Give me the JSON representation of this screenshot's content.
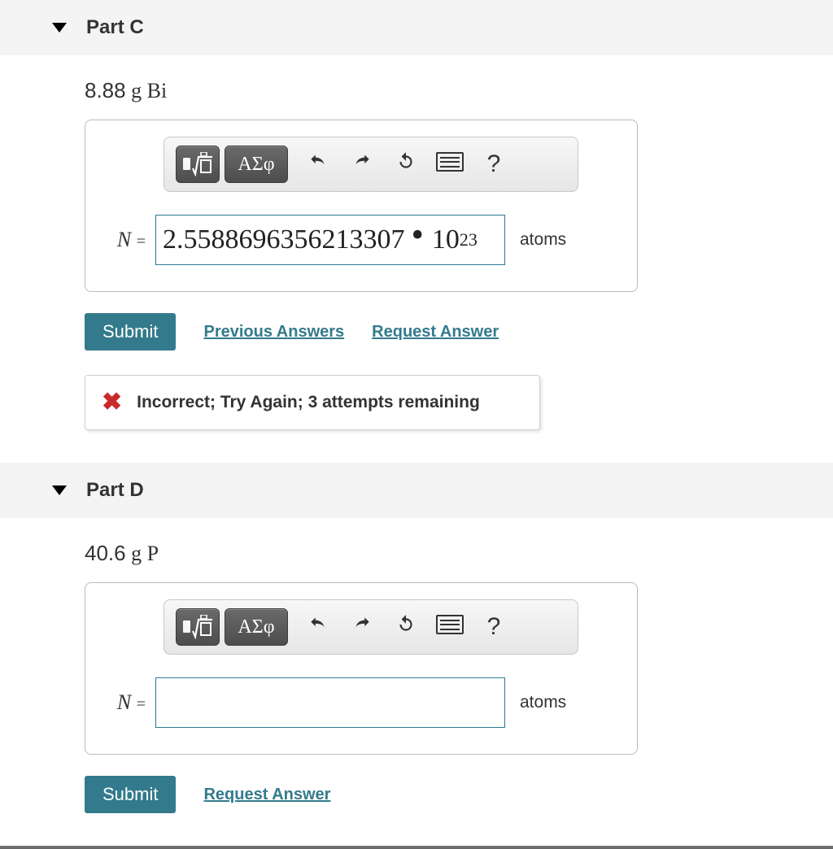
{
  "parts": {
    "c": {
      "title": "Part C",
      "prompt_value": "8.88",
      "prompt_unit": "g",
      "prompt_element": "Bi",
      "var": "N",
      "eq": "=",
      "answer_mantissa": "2.5588696356213307",
      "answer_base": "10",
      "answer_exp": "23",
      "unit_label": "atoms",
      "submit_label": "Submit",
      "prev_answers_label": "Previous Answers",
      "request_answer_label": "Request Answer",
      "feedback": "Incorrect; Try Again; 3 attempts remaining"
    },
    "d": {
      "title": "Part D",
      "prompt_value": "40.6",
      "prompt_unit": "g",
      "prompt_element": "P",
      "var": "N",
      "eq": "=",
      "answer_mantissa": "",
      "unit_label": "atoms",
      "submit_label": "Submit",
      "request_answer_label": "Request Answer"
    }
  },
  "toolbar": {
    "symbols_label": "ΑΣφ",
    "help_label": "?"
  }
}
